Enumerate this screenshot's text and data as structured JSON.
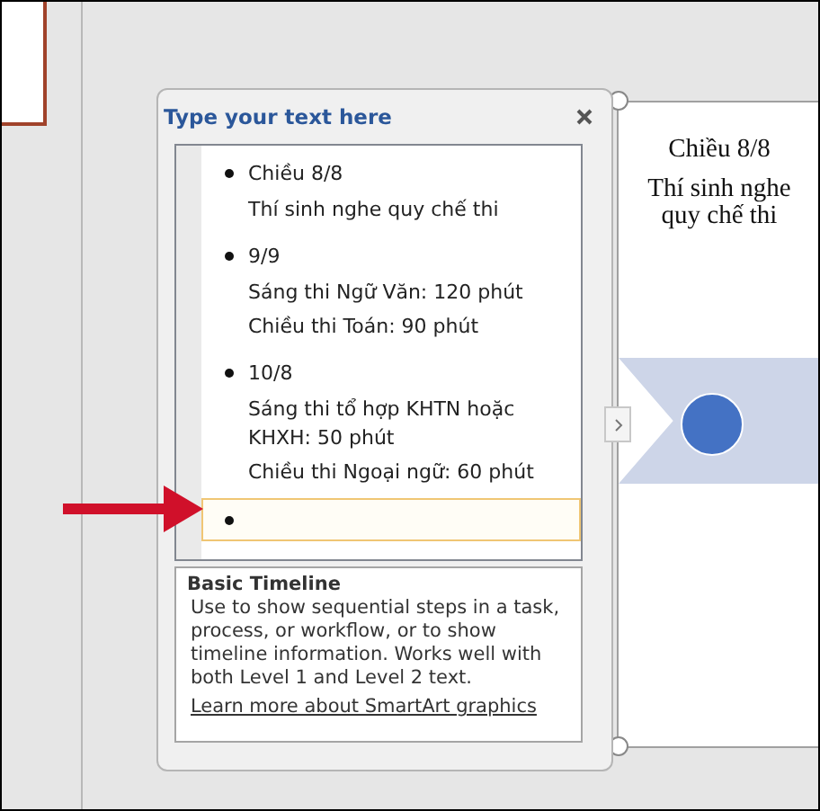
{
  "text_pane": {
    "title": "Type your text here",
    "items": [
      {
        "kind": "bullet",
        "text": "Chiều 8/8",
        "selected": false,
        "children": [
          {
            "text": "Thí sinh nghe quy chế thi"
          }
        ]
      },
      {
        "kind": "bullet",
        "text": "9/9",
        "selected": false,
        "children": [
          {
            "text": "Sáng thi Ngữ Văn: 120  phút"
          },
          {
            "text": "Chiều thi  Toán: 90 phút"
          }
        ]
      },
      {
        "kind": "bullet",
        "text": "10/8",
        "selected": false,
        "children": [
          {
            "text": "Sáng thi tổ hợp KHTN hoặc KHXH: 50 phút"
          },
          {
            "text": "Chiều thi Ngoại ngữ: 60 phút"
          }
        ]
      },
      {
        "kind": "empty",
        "selected": true
      }
    ]
  },
  "description": {
    "title": "Basic Timeline",
    "text": "Use to show sequential steps in a task, process, or workflow, or to show timeline information. Works well with both Level 1 and Level 2 text.",
    "link": "Learn more about SmartArt graphics"
  },
  "slide": {
    "heading": "Chiều 8/8",
    "subtext": "Thí sinh nghe quy chế thi"
  }
}
